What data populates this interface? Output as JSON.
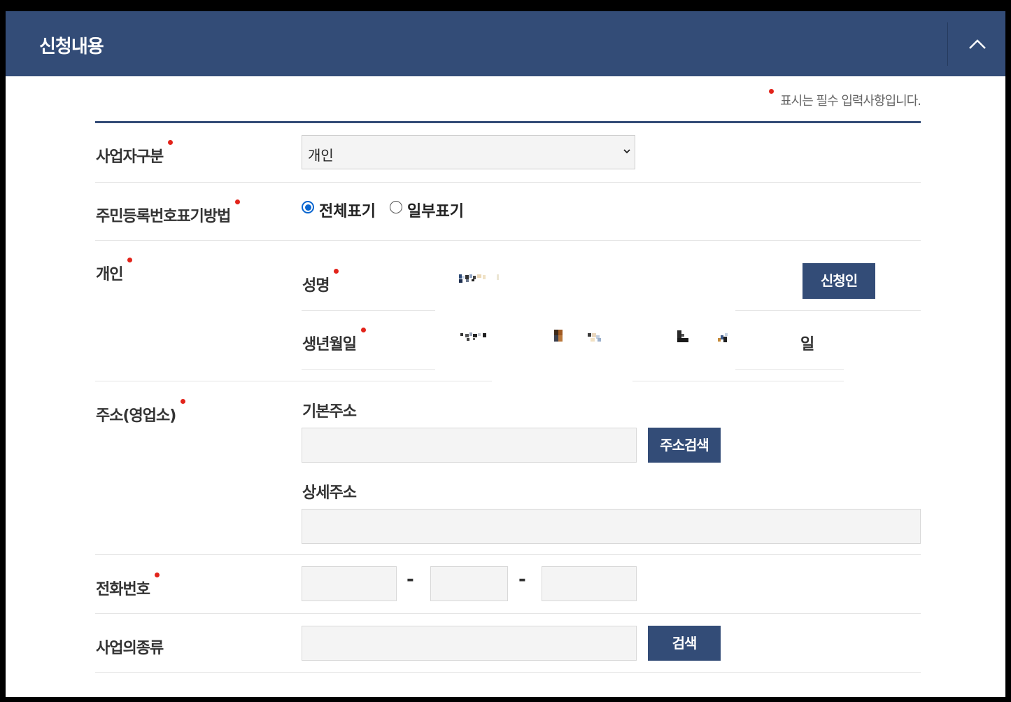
{
  "header": {
    "title": "신청내용",
    "toggle_icon": "chevron-up-icon"
  },
  "required_note": "표시는 필수 입력사항입니다.",
  "colors": {
    "primary": "#334c77",
    "required_dot": "#e2231a",
    "radio_selected": "#0a66d0",
    "field_bg": "#f4f4f4"
  },
  "form": {
    "business_type": {
      "label": "사업자구분",
      "selected": "개인"
    },
    "id_display": {
      "label": "주민등록번호표기방법",
      "options": [
        {
          "label": "전체표기",
          "selected": true
        },
        {
          "label": "일부표기",
          "selected": false
        }
      ]
    },
    "individual": {
      "label": "개인",
      "name_label": "성명",
      "applicant_button": "신청인",
      "birth_label": "생년월일",
      "day_unit": "일"
    },
    "address": {
      "label": "주소(영업소)",
      "base_label": "기본주소",
      "search_button": "주소검색",
      "detail_label": "상세주소"
    },
    "phone": {
      "label": "전화번호",
      "separator": "-"
    },
    "business_kind": {
      "label": "사업의종류",
      "search_button": "검색"
    }
  }
}
